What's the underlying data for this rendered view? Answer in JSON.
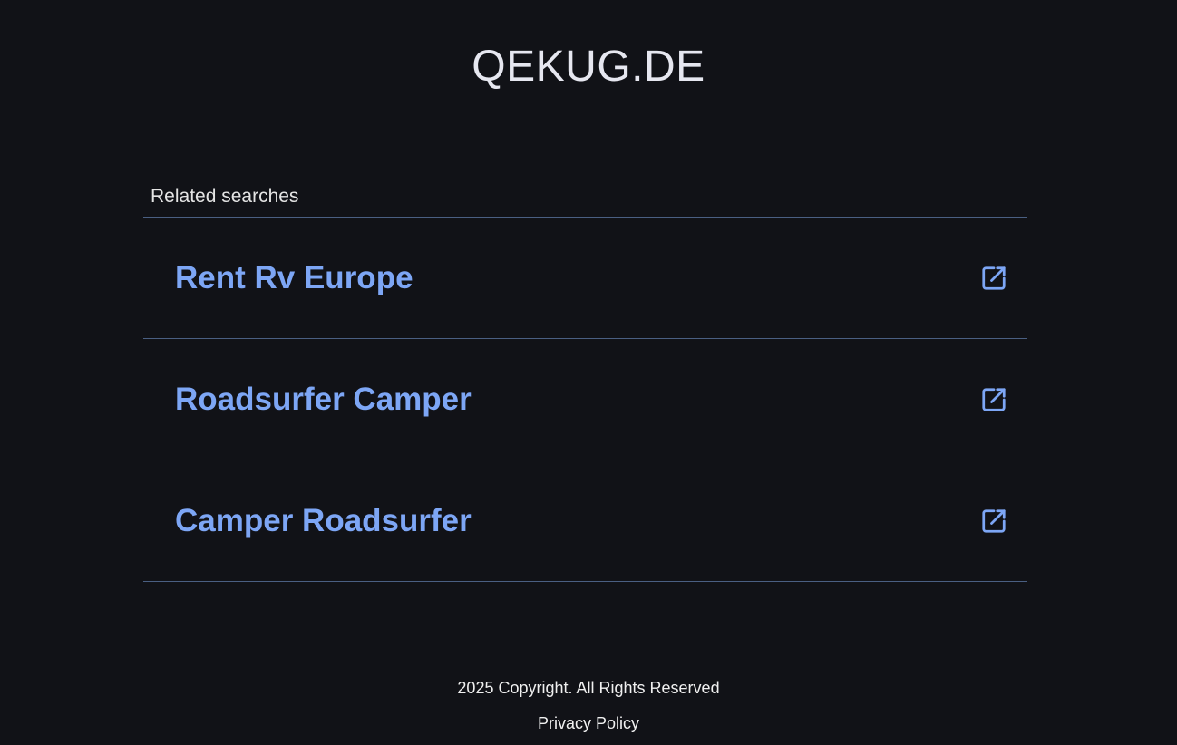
{
  "header": {
    "site_title": "QEKUG.DE"
  },
  "related": {
    "heading": "Related searches",
    "items": [
      {
        "label": "Rent Rv Europe",
        "icon": "external-link-icon"
      },
      {
        "label": "Roadsurfer Camper",
        "icon": "external-link-icon"
      },
      {
        "label": "Camper Roadsurfer",
        "icon": "external-link-icon"
      }
    ]
  },
  "footer": {
    "copyright": "2025 Copyright. All Rights Reserved",
    "privacy_label": "Privacy Policy"
  },
  "colors": {
    "background": "#111217",
    "link": "#7da6f5",
    "divider": "#4a5f82",
    "text": "#e6e7f0"
  }
}
